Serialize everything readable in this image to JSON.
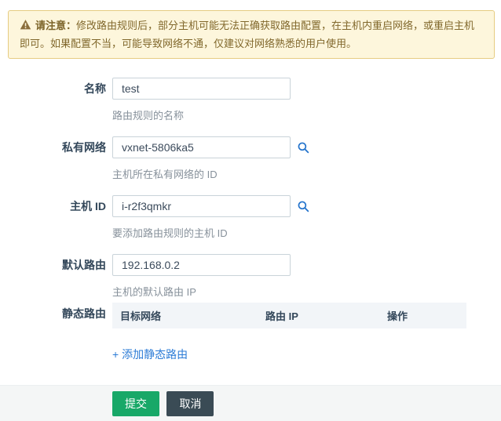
{
  "banner": {
    "icon": "warning-icon",
    "notice_label": "请注意：",
    "message": "修改路由规则后，部分主机可能无法正确获取路由配置，在主机内重启网络，或重启主机即可。如果配置不当，可能导致网络不通，仅建议对网络熟悉的用户使用。"
  },
  "form": {
    "fields": [
      {
        "label": "名称",
        "value": "test",
        "helper": "路由规则的名称",
        "has_search": false
      },
      {
        "label": "私有网络",
        "value": "vxnet-5806ka5",
        "helper": "主机所在私有网络的 ID",
        "has_search": true
      },
      {
        "label": "主机 ID",
        "value": "i-r2f3qmkr",
        "helper": "要添加路由规则的主机 ID",
        "has_search": true
      },
      {
        "label": "默认路由",
        "value": "192.168.0.2",
        "helper": "主机的默认路由 IP",
        "has_search": false
      }
    ],
    "static_routes": {
      "label": "静态路由",
      "columns": [
        "目标网络",
        "路由 IP",
        "操作"
      ],
      "rows": [],
      "add_link": "+ 添加静态路由"
    }
  },
  "footer": {
    "submit_label": "提交",
    "cancel_label": "取消"
  },
  "colors": {
    "accent_green": "#18a868",
    "cancel_dark": "#3a4b55",
    "link_blue": "#2b7bd6",
    "search_icon_blue": "#2373cc",
    "banner_bg": "#fdf6dc",
    "banner_border": "#e6cc82",
    "banner_text": "#81682c",
    "label_text": "#33475a",
    "helper_text": "#87919b",
    "table_header_bg": "#f2f5f8",
    "footer_bg": "#f4f6f6"
  }
}
